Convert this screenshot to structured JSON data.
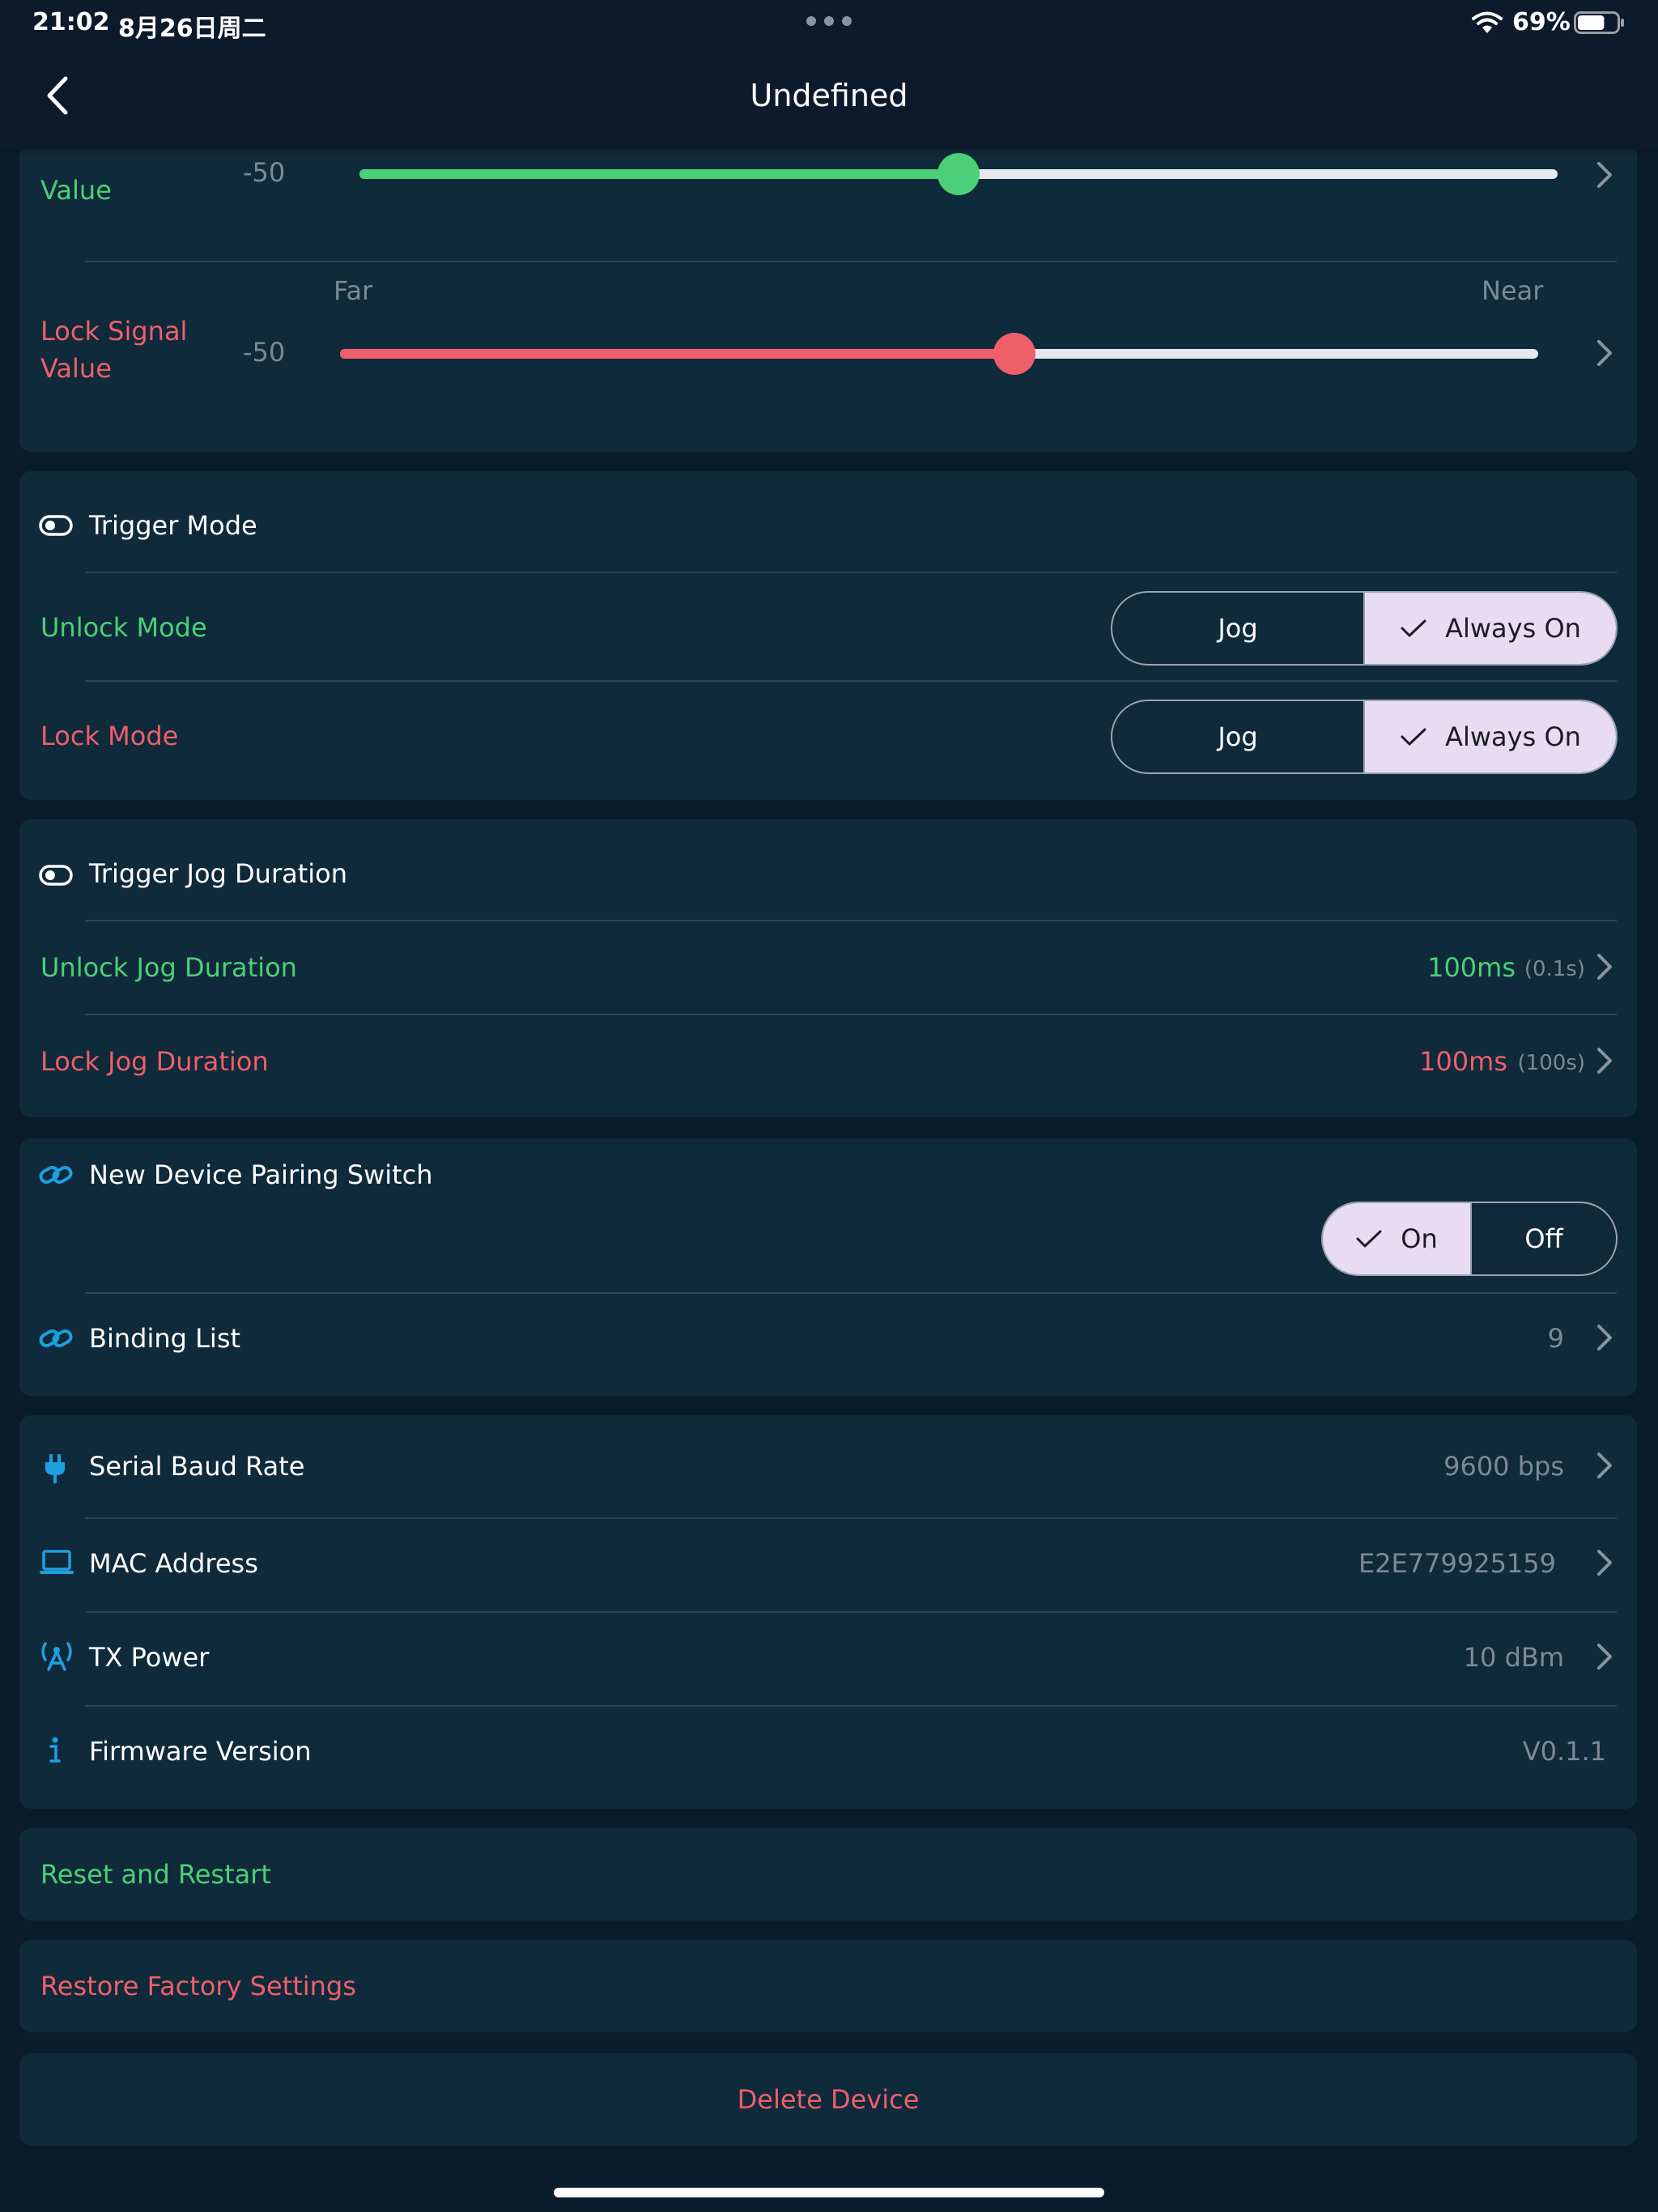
{
  "status_bar": {
    "time": "21:02",
    "date": "8月26日周二",
    "battery_percent": "69%",
    "battery_level": 0.69
  },
  "nav": {
    "title": "Undefined",
    "back_icon": "chevron-left-icon"
  },
  "signal_card": {
    "unlock_label": "Value",
    "unlock_value": "-50",
    "unlock_slider_fraction": 0.5,
    "far_label": "Far",
    "near_label": "Near",
    "lock_label_line1": "Lock Signal",
    "lock_label_line2": "Value",
    "lock_value": "-50",
    "lock_slider_fraction": 0.5625
  },
  "trigger_mode": {
    "title": "Trigger Mode",
    "icon": "toggle-icon",
    "unlock_label": "Unlock Mode",
    "lock_label": "Lock Mode",
    "options": [
      "Jog",
      "Always On"
    ],
    "unlock_selected": "Always On",
    "lock_selected": "Always On"
  },
  "jog_duration": {
    "title": "Trigger Jog Duration",
    "icon": "toggle-icon",
    "unlock_label": "Unlock Jog Duration",
    "unlock_value": "100ms",
    "unlock_hint": "(0.1s)",
    "lock_label": "Lock Jog Duration",
    "lock_value": "100ms",
    "lock_hint": "(100s)"
  },
  "pairing": {
    "title": "New Device Pairing Switch",
    "icon": "link-icon",
    "options": [
      "On",
      "Off"
    ],
    "selected": "On",
    "binding_label": "Binding List",
    "binding_count": "9"
  },
  "device_info": {
    "baud_label": "Serial Baud Rate",
    "baud_value": "9600 bps",
    "mac_label": "MAC Address",
    "mac_value": "E2E779925159",
    "tx_label": "TX Power",
    "tx_value": "10 dBm",
    "fw_label": "Firmware Version",
    "fw_value": "V0.1.1"
  },
  "actions": {
    "reset": "Reset and Restart",
    "restore": "Restore Factory Settings",
    "delete": "Delete Device"
  },
  "colors": {
    "background": "#0a1c2b",
    "card": "#0f2a3a",
    "accent_green": "#4cd077",
    "accent_red": "#ee5f6a",
    "accent_blue": "#1ea0e0",
    "segment_selected": "#e8dcf3"
  }
}
